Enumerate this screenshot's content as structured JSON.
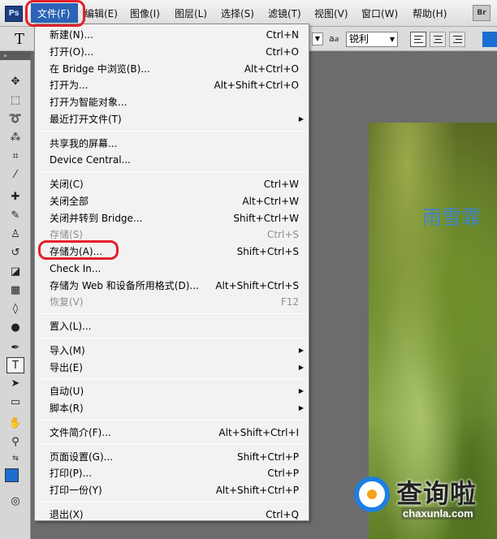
{
  "app": {
    "logo_text": "Ps",
    "bridge_button": "Br"
  },
  "menubar": {
    "items": [
      "文件(F)",
      "编辑(E)",
      "图像(I)",
      "图层(L)",
      "选择(S)",
      "滤镜(T)",
      "视图(V)",
      "窗口(W)",
      "帮助(H)"
    ]
  },
  "options_bar": {
    "tool_glyph": "T",
    "aa_label": "a",
    "aa_label_small": "a",
    "antialias_value": "锐利"
  },
  "canvas": {
    "photo_text": "雨雪霏"
  },
  "file_menu": {
    "groups": [
      [
        {
          "label": "新建(N)...",
          "shortcut": "Ctrl+N"
        },
        {
          "label": "打开(O)...",
          "shortcut": "Ctrl+O"
        },
        {
          "label": "在 Bridge 中浏览(B)...",
          "shortcut": "Alt+Ctrl+O"
        },
        {
          "label": "打开为...",
          "shortcut": "Alt+Shift+Ctrl+O"
        },
        {
          "label": "打开为智能对象...",
          "shortcut": ""
        },
        {
          "label": "最近打开文件(T)",
          "shortcut": "",
          "submenu": true
        }
      ],
      [
        {
          "label": "共享我的屏幕...",
          "shortcut": ""
        },
        {
          "label": "Device Central...",
          "shortcut": ""
        }
      ],
      [
        {
          "label": "关闭(C)",
          "shortcut": "Ctrl+W"
        },
        {
          "label": "关闭全部",
          "shortcut": "Alt+Ctrl+W"
        },
        {
          "label": "关闭并转到 Bridge...",
          "shortcut": "Shift+Ctrl+W"
        },
        {
          "label": "存储(S)",
          "shortcut": "Ctrl+S",
          "disabled": true
        },
        {
          "label": "存储为(A)...",
          "shortcut": "Shift+Ctrl+S"
        },
        {
          "label": "Check In...",
          "shortcut": ""
        },
        {
          "label": "存储为 Web 和设备所用格式(D)...",
          "shortcut": "Alt+Shift+Ctrl+S"
        },
        {
          "label": "恢复(V)",
          "shortcut": "F12",
          "disabled": true
        }
      ],
      [
        {
          "label": "置入(L)...",
          "shortcut": ""
        }
      ],
      [
        {
          "label": "导入(M)",
          "shortcut": "",
          "submenu": true
        },
        {
          "label": "导出(E)",
          "shortcut": "",
          "submenu": true
        }
      ],
      [
        {
          "label": "自动(U)",
          "shortcut": "",
          "submenu": true
        },
        {
          "label": "脚本(R)",
          "shortcut": "",
          "submenu": true
        }
      ],
      [
        {
          "label": "文件简介(F)...",
          "shortcut": "Alt+Shift+Ctrl+I"
        }
      ],
      [
        {
          "label": "页面设置(G)...",
          "shortcut": "Shift+Ctrl+P"
        },
        {
          "label": "打印(P)...",
          "shortcut": "Ctrl+P"
        },
        {
          "label": "打印一份(Y)",
          "shortcut": "Alt+Shift+Ctrl+P"
        }
      ],
      [
        {
          "label": "退出(X)",
          "shortcut": "Ctrl+Q"
        }
      ]
    ]
  },
  "watermark": {
    "text": "查询啦",
    "url": "chaxunla.com"
  },
  "colors": {
    "accent_blue": "#2b63b7",
    "highlight_red": "#e3202a",
    "foreground_swatch": "#1b6dd1"
  }
}
